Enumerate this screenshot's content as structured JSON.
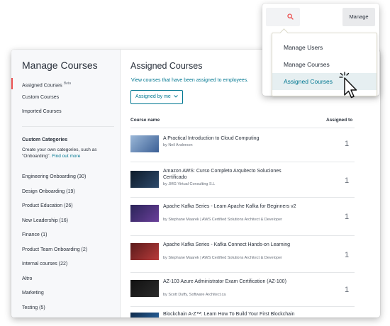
{
  "sidebar": {
    "title": "Manage Courses",
    "nav": [
      {
        "label": "Assigned Courses",
        "badge": "Beta",
        "active": true
      },
      {
        "label": "Custom Courses"
      },
      {
        "label": "Imported Courses"
      }
    ],
    "custom_categories": {
      "title": "Custom Categories",
      "description": "Create your own categories, such as \"Onboarding\".",
      "link": "Find out more"
    },
    "categories": [
      "Engineering Onboarding (30)",
      "Design Onboarding (19)",
      "Product Education (26)",
      "New Leadership (16)",
      "Finance (1)",
      "Product Team Onboarding (2)",
      "Internal courses (22)",
      "Altro",
      "Marketing",
      "Testing (5)"
    ]
  },
  "main": {
    "title": "Assigned Courses",
    "subtitle": "View courses that have been assigned to employees.",
    "filter_label": "Assigned by me",
    "filter_icon": "chevron-down-icon",
    "columns": {
      "course": "Course name",
      "assigned": "Assigned to"
    },
    "courses": [
      {
        "title": "A Practical Introduction to Cloud Computing",
        "by": "by Neil Anderson",
        "count": "1"
      },
      {
        "title": "Amazon AWS: Curso Completo Arquitecto Soluciones Certificado",
        "by": "by JMG Virtual Consulting S.L",
        "count": "1"
      },
      {
        "title": "Apache Kafka Series - Learn Apache Kafka for Beginners v2",
        "by": "by Stephane Maarek | AWS Certified Solutions Architect & Developer",
        "count": "1"
      },
      {
        "title": "Apache Kafka Series - Kafka Connect Hands-on Learning",
        "by": "by Stephane Maarek | AWS Certified Solutions Architect & Developer",
        "count": "1"
      },
      {
        "title": "AZ-103 Azure Administrator Exam Certification (AZ-100)",
        "by": "by Scott Duffy, Software Architect.ca",
        "count": "1"
      },
      {
        "title": "Blockchain A-Z™: Learn How To Build Your First Blockchain",
        "by": "",
        "count": ""
      }
    ]
  },
  "popover": {
    "search_icon": "search-icon",
    "manage_button": "Manage",
    "menu": [
      {
        "label": "Manage Users"
      },
      {
        "label": "Manage Courses"
      },
      {
        "label": "Assigned Courses",
        "active": true
      }
    ]
  },
  "colors": {
    "accent": "#007791",
    "active_marker": "#ec5252",
    "search_icon": "#ec5252"
  }
}
